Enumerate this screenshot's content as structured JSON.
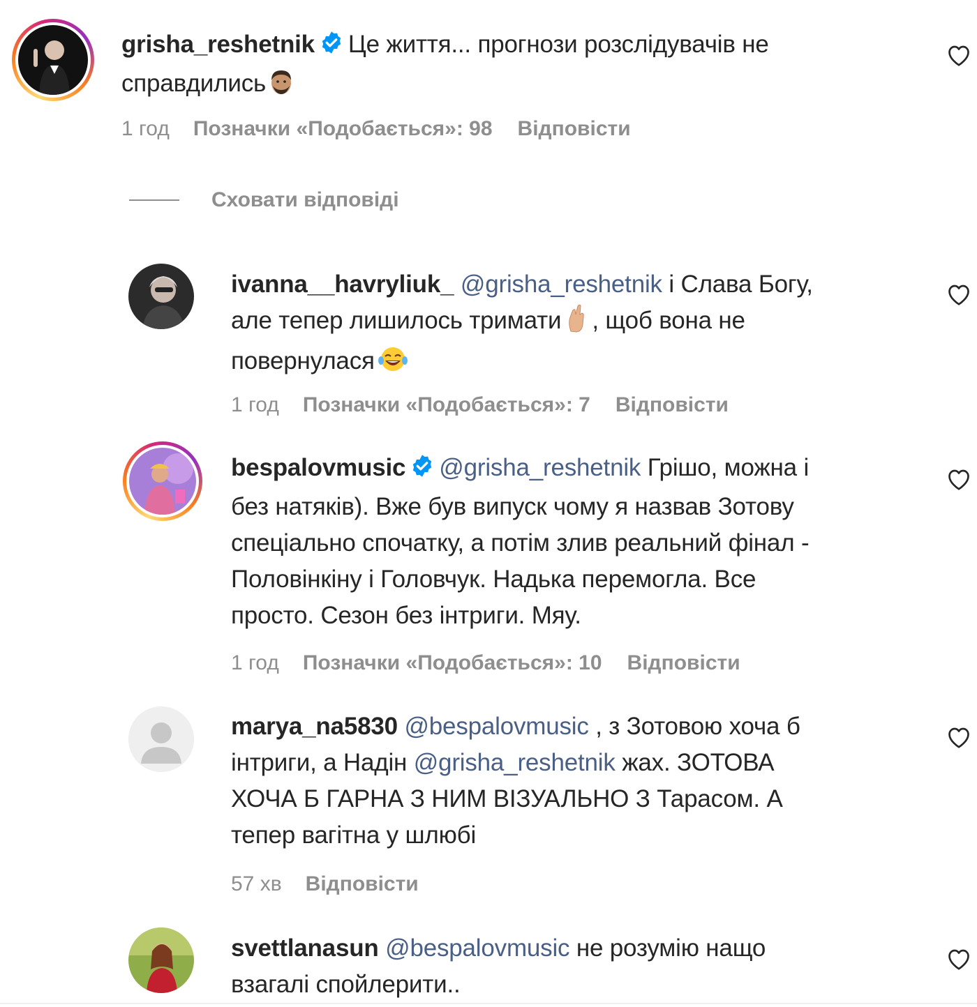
{
  "comments": [
    {
      "username": "grisha_reshetnik",
      "verified": true,
      "mention": "",
      "text_line1": "Це життя... прогнози розслідувачів не",
      "text_line2": "справдились",
      "emoji": "man-face-emoji",
      "time": "1 год",
      "likes": "Позначки «Подобається»: 98",
      "reply": "Відповісти"
    },
    {
      "username": "ivanna__havryliuk_",
      "verified": false,
      "mention": "@grisha_reshetnik",
      "text_line1": "і Слава Богу,",
      "text_line2": "але тепер лишилось тримати",
      "text_line2b": ", щоб вона не",
      "text_line3": "повернулася",
      "time": "1 год",
      "likes": "Позначки «Подобається»: 7",
      "reply": "Відповісти"
    },
    {
      "username": "bespalovmusic",
      "verified": true,
      "mention": "@grisha_reshetnik",
      "text_line1": "Грішо, можна і",
      "text_line2": "без натяків). Вже був випуск чому я назвав Зотову",
      "text_line3": "спеціально спочатку, а потім злив реальний фінал -",
      "text_line4": "Половінкіну і Головчук. Надька перемогла. Все",
      "text_line5": "просто. Сезон без інтриги. Мяу.",
      "time": "1 год",
      "likes": "Позначки «Подобається»: 10",
      "reply": "Відповісти"
    },
    {
      "username": "marya_na5830",
      "verified": false,
      "mention": "@bespalovmusic",
      "text_line1": ", з Зотовою хоча б",
      "text_line2a": "інтриги, а Надін",
      "mention2": "@grisha_reshetnik",
      "text_line2b": "жах. ЗОТОВА",
      "text_line3": "ХОЧА Б ГАРНА З НИМ ВІЗУАЛЬНО З Тарасом. А",
      "text_line4": "тепер вагітна у шлюбі",
      "time": "57 хв",
      "reply": "Відповісти"
    },
    {
      "username": "svettlanasun",
      "verified": false,
      "mention": "@bespalovmusic",
      "text_line1": "не розумію нащо",
      "text_line2": "взагалі спойлерити.."
    }
  ],
  "hide_replies": "Сховати відповіді",
  "colors": {
    "text": "#262626",
    "secondary": "#8e8e8e",
    "mention": "#4a5f85",
    "verified": "#0095f6"
  }
}
